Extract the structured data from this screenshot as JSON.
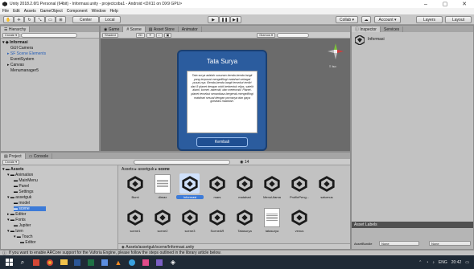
{
  "window": {
    "title": "Unity 2018.2.6f1 Personal (64bit) - Informasi.unity - projectcoba1 - Android <DX11 on DX9 GPU>",
    "controls": [
      "–",
      "▢",
      "✕"
    ]
  },
  "menubar": [
    "File",
    "Edit",
    "Assets",
    "GameObject",
    "Component",
    "Window",
    "Help"
  ],
  "toolbar": {
    "center_label": "Center",
    "local_label": "Local",
    "collab_label": "Collab ▾",
    "account_label": "Account ▾",
    "layers_label": "Layers",
    "layout_label": "Layout"
  },
  "hierarchy": {
    "tab": "Hierarchy",
    "create_label": "Create ▾",
    "scene": "Informasi",
    "items": [
      "GUI Camera",
      "SF Scene Elements",
      "EventSystem",
      "Canvas",
      "Menumanager5"
    ]
  },
  "scene_tabs": {
    "game": "Game",
    "scene": "Scene",
    "asset_store": "Asset Store",
    "animator": "Animator",
    "shaded": "Shaded",
    "mode_2d": "2D",
    "gizmos": "Gizmos ▾",
    "persp": "≡ Iso"
  },
  "game_view": {
    "heading": "Tata Surya",
    "paragraph": "Tata surya adalah susunan benda-benda langit yang terpusat mengelilingi matahari sebagai pusat-nya. Benda-benda langit tersebut terdiri dari 8 planet dengan orbit berbentuk elips, satelit alami, komet, asteroid, dan meteoroid. Planet-planet tersebut senantiasa bergerak mengelilingi matahari sesuai dengan porosnya dan gaya gravitasi matahari.",
    "button": "Kembali"
  },
  "inspector": {
    "tab": "Inspector",
    "services_tab": "Services",
    "object_name": "Informasi",
    "asset_labels": "Asset Labels",
    "assetbundle_label": "AssetBundle",
    "assetbundle_value": "None",
    "assetbundle_variant": "None"
  },
  "project": {
    "tab": "Project",
    "console_tab": "Console",
    "create_label": "Create ▾",
    "breadcrumb": [
      "Assets",
      "assetguk",
      "scene"
    ],
    "tree": [
      {
        "label": "Assets",
        "level": 0,
        "bold": true
      },
      {
        "label": "Animation",
        "level": 1
      },
      {
        "label": "MainMenu",
        "level": 2
      },
      {
        "label": "Panel",
        "level": 2
      },
      {
        "label": "Settings",
        "level": 2
      },
      {
        "label": "assetguk",
        "level": 1
      },
      {
        "label": "model",
        "level": 2
      },
      {
        "label": "scene",
        "level": 2,
        "selected": true
      },
      {
        "label": "Editor",
        "level": 1
      },
      {
        "label": "Fonts",
        "level": 1
      },
      {
        "label": "Jupiter",
        "level": 2
      },
      {
        "label": "Izen",
        "level": 1
      },
      {
        "label": "Touch",
        "level": 2
      },
      {
        "label": "Editor",
        "level": 3
      }
    ],
    "assets_row1": [
      {
        "name": "Bumi",
        "kind": "unity"
      },
      {
        "name": "dimax",
        "kind": "doc"
      },
      {
        "name": "Informasi",
        "kind": "unity",
        "selected": true
      },
      {
        "name": "mars",
        "kind": "unity"
      },
      {
        "name": "matahari",
        "kind": "unity"
      },
      {
        "name": "MenuUtama",
        "kind": "unity"
      },
      {
        "name": "ProfilePeng...",
        "kind": "unity"
      },
      {
        "name": "saturnus",
        "kind": "unity"
      }
    ],
    "assets_row2": [
      {
        "name": "scene1",
        "kind": "unity"
      },
      {
        "name": "scene2",
        "kind": "unity"
      },
      {
        "name": "scene3",
        "kind": "unity"
      },
      {
        "name": "SceneAR",
        "kind": "unity"
      },
      {
        "name": "Tatasurya",
        "kind": "unity"
      },
      {
        "name": "tatasurya",
        "kind": "doc"
      },
      {
        "name": "venus",
        "kind": "unity"
      }
    ],
    "footer_path": "Assets/assetguk/scene/Informasi.unity",
    "count_badge": "14"
  },
  "status": {
    "message": "If you want to enable ARCore support for the Vuforia Engine, please follow the steps outlined in the library article below."
  },
  "taskbar": {
    "tray_lang": "ENG",
    "time": "20:42"
  },
  "colors": {
    "unity_icon": "#1a1a1a",
    "selection": "#3d7bd8",
    "game_bg": "#2b5c9e",
    "taskbar": "#1f2a36"
  }
}
